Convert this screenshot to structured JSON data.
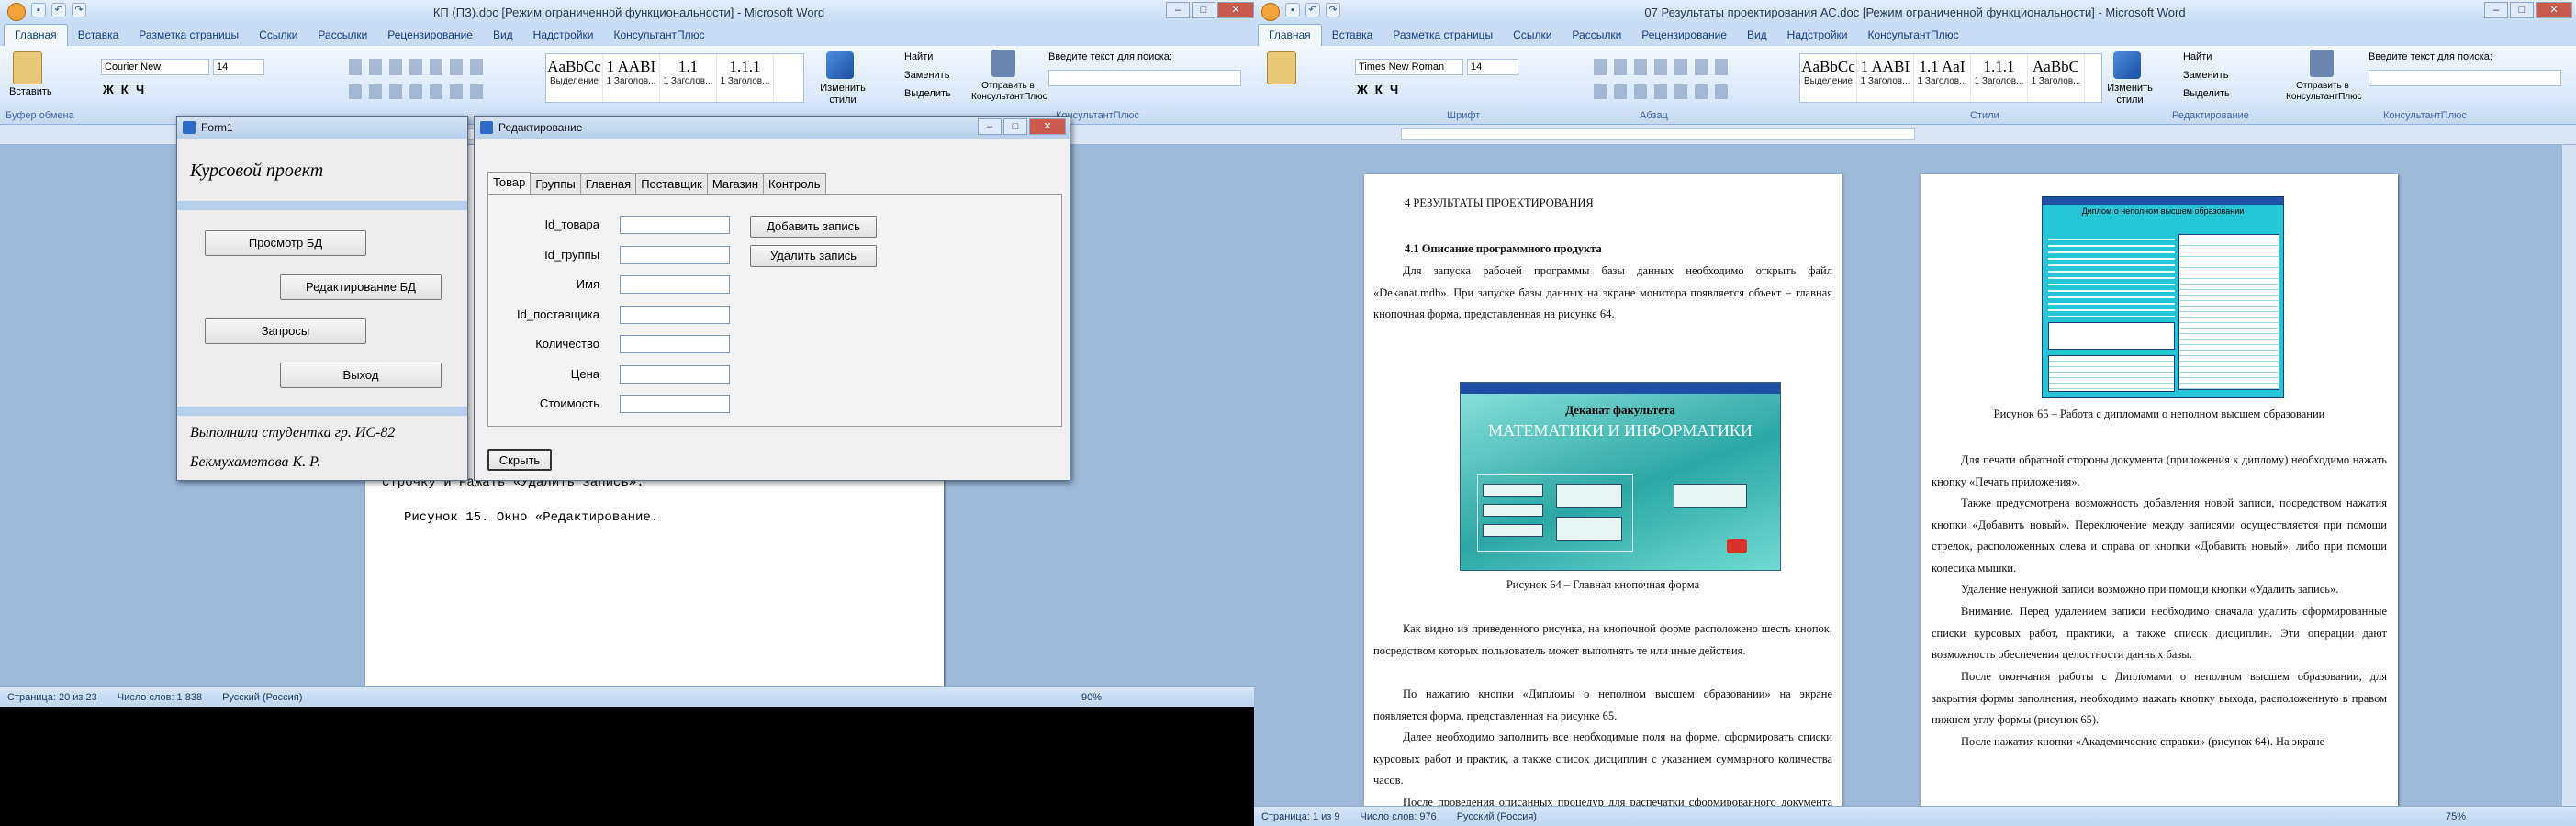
{
  "left_window": {
    "title": "КП (ПЗ).doc [Режим ограниченной функциональности] - Microsoft Word",
    "tabs": [
      "Главная",
      "Вставка",
      "Разметка страницы",
      "Ссылки",
      "Рассылки",
      "Рецензирование",
      "Вид",
      "Надстройки",
      "КонсультантПлюс"
    ],
    "paste_label": "Вставить",
    "font_name": "Courier New",
    "font_size": "14",
    "styles": [
      {
        "sample": "AaBbCc",
        "name": "Выделение"
      },
      {
        "sample": "1 AABI",
        "name": "1 Заголов..."
      },
      {
        "sample": "1.1",
        "name": "1 Заголов..."
      },
      {
        "sample": "1.1.1",
        "name": "1 Заголов..."
      }
    ],
    "find_label": "Найти",
    "replace_label": "Заменить",
    "select_label": "Выделить",
    "change_styles": "Изменить стили",
    "consultant": "Отправить в КонсультантПлюс",
    "search_label": "Введите текст для поиска:",
    "clipboard_label": "Буфер обмена",
    "consultant_group": "КонсультантПлюс",
    "doc_line1": "строчку и нажать «Удалить запись».",
    "doc_line2": "Рисунок 15. Окно «Редактирование.",
    "status": {
      "page": "Страница: 20 из 23",
      "words": "Число слов: 1 838",
      "lang": "Русский (Россия)",
      "zoom": "90%"
    }
  },
  "form1": {
    "title": "Form1",
    "heading": "Курсовой проект",
    "buttons": [
      "Просмотр БД",
      "Редактирование БД",
      "Запросы",
      "Выход"
    ],
    "footer1": "Выполнила студентка гр. ИС-82",
    "footer2": "Бекмухаметова К. Р."
  },
  "edit_dialog": {
    "title": "Редактирование",
    "tabs": [
      "Товар",
      "Группы",
      "Главная",
      "Поставщик",
      "Магазин",
      "Контроль"
    ],
    "fields": [
      "Id_товара",
      "Id_группы",
      "Имя",
      "Id_поставщика",
      "Количество",
      "Цена",
      "Стоимость"
    ],
    "add_button": "Добавить запись",
    "delete_button": "Удалить запись",
    "hide_button": "Скрыть"
  },
  "right_window": {
    "title": "07 Результаты проектирования АС.doc [Режим ограниченной функциональности] - Microsoft Word",
    "tabs": [
      "Главная",
      "Вставка",
      "Разметка страницы",
      "Ссылки",
      "Рассылки",
      "Рецензирование",
      "Вид",
      "Надстройки",
      "КонсультантПлюс"
    ],
    "font_name": "Times New Roman",
    "font_size": "14",
    "styles": [
      {
        "sample": "AaBbCc",
        "name": "Выделение"
      },
      {
        "sample": "1 AABI",
        "name": "1 Заголов..."
      },
      {
        "sample": "1.1 AaI",
        "name": "1 Заголов..."
      },
      {
        "sample": "1.1.1",
        "name": "1 Заголов..."
      },
      {
        "sample": "AaBbC",
        "name": "1 Заголов..."
      }
    ],
    "groups": [
      "Шрифт",
      "Абзац",
      "Стили",
      "Редактирование",
      "КонсультантПлюс"
    ],
    "find_label": "Найти",
    "replace_label": "Заменить",
    "select_label": "Выделить",
    "change_styles": "Изменить стили",
    "consultant": "Отправить в КонсультантПлюс",
    "search_label": "Введите текст для поиска:",
    "page1": {
      "heading": "4 РЕЗУЛЬТАТЫ ПРОЕКТИРОВАНИЯ",
      "subheading": "4.1 Описание программного продукта",
      "p1": "Для запуска рабочей программы базы данных необходимо открыть файл «Dekanat.mdb». При запуске базы данных на экране монитора появляется объект – главная кнопочная форма, представленная на рисунке 64.",
      "fig_title": "Деканат факультета",
      "fig_subtitle": "МАТЕМАТИКИ И ИНФОРМАТИКИ",
      "fig_caption": "Рисунок 64 – Главная кнопочная форма",
      "p2": "Как видно из приведенного рисунка, на кнопочной форме расположено шесть кнопок, посредством которых пользователь может выполнять те или иные действия.",
      "p3": "По нажатию кнопки «Дипломы о неполном высшем образовании» на экране появляется форма, представленная на рисунке 65.",
      "p4": "Далее необходимо заполнить все необходимые поля на форме, сформировать списки курсовых работ и практик, а также список дисциплин с указанием суммарного количества часов.",
      "p5": "После проведения описанных процедур для распечатки сформированного документа необходимо сначала нажать кнопку «Печать диплома», при этом на печать"
    },
    "page2": {
      "fig_title": "Диплом о неполном высшем образовании",
      "fig_caption": "Рисунок 65 – Работа с дипломами о неполном высшем образовании",
      "p1": "Для печати обратной стороны документа (приложения к диплому) необходимо нажать кнопку «Печать приложения».",
      "p2": "Также предусмотрена возможность добавления новой записи, посредством нажатия кнопки «Добавить новый». Переключение между записями осуществляется при помощи стрелок, расположенных слева и справа от кнопки «Добавить новый», либо при помощи колесика мышки.",
      "p3": "Удаление ненужной записи возможно при помощи кнопки «Удалить запись».",
      "p4": "Внимание. Перед удалением записи необходимо сначала удалить сформированные списки курсовых работ, практики, а также список дисциплин. Эти операции дают возможность обеспечения целостности данных базы.",
      "p5": "После окончания работы с Дипломами о неполном высшем образовании, для закрытия формы заполнения, необходимо нажать кнопку выхода, расположенную в правом нижнем углу формы (рисунок 65).",
      "p6": "После нажатия кнопки «Академические справки» (рисунок 64). На экране"
    },
    "status": {
      "page": "Страница: 1 из 9",
      "words": "Число слов: 976",
      "lang": "Русский (Россия)",
      "zoom": "75%"
    }
  }
}
